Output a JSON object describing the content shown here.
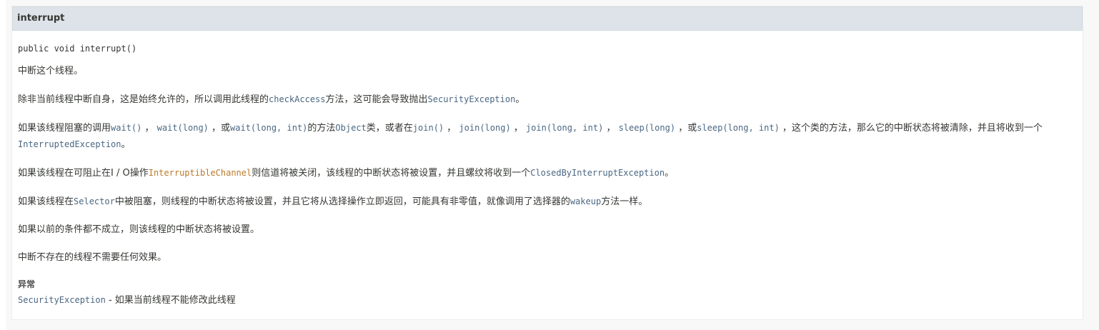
{
  "method": {
    "name": "interrupt",
    "signature": "public void interrupt()"
  },
  "description": {
    "p1": "中断这个线程。",
    "p2": {
      "t1": "除非当前线程中断自身，这是始终允许的，所以调用此线程的",
      "c1": "checkAccess",
      "t2": "方法，这可能会导致抛出",
      "c2": "SecurityException",
      "t3": "。"
    },
    "p3": {
      "t1": "如果该线程阻塞的调用",
      "c1": "wait()",
      "t2": " ， ",
      "c2": "wait(long)",
      "t3": " ，或",
      "c3": "wait(long, int)",
      "t4": "的方法",
      "c4": "Object",
      "t5": "类，或者在",
      "c5": "join()",
      "t6": " ， ",
      "c6": "join(long)",
      "t7": " ， ",
      "c7": "join(long, int)",
      "t8": " ， ",
      "c8": "sleep(long)",
      "t9": " ，或",
      "c9": "sleep(long, int)",
      "t10": " ，这个类的方法，那么它的中断状态将被清除，并且将收到一个",
      "c10": "InterruptedException",
      "t11": "。"
    },
    "p4": {
      "t1": "如果该线程在可阻止在I / O操作",
      "c1": "InterruptibleChannel",
      "t2": "则信道将被关闭，该线程的中断状态将被设置，并且螺纹将收到一个",
      "c2": "ClosedByInterruptException",
      "t3": "。"
    },
    "p5": {
      "t1": "如果该线程在",
      "c1": "Selector",
      "t2": "中被阻塞，则线程的中断状态将被设置，并且它将从选择操作立即返回，可能具有非零值，就像调用了选择器的",
      "c2": "wakeup",
      "t3": "方法一样。"
    },
    "p6": "如果以前的条件都不成立，则该线程的中断状态将被设置。",
    "p7": "中断不存在的线程不需要任何效果。"
  },
  "throws": {
    "label": "异常",
    "exception": "SecurityException",
    "desc": " - 如果当前线程不能修改此线程"
  }
}
